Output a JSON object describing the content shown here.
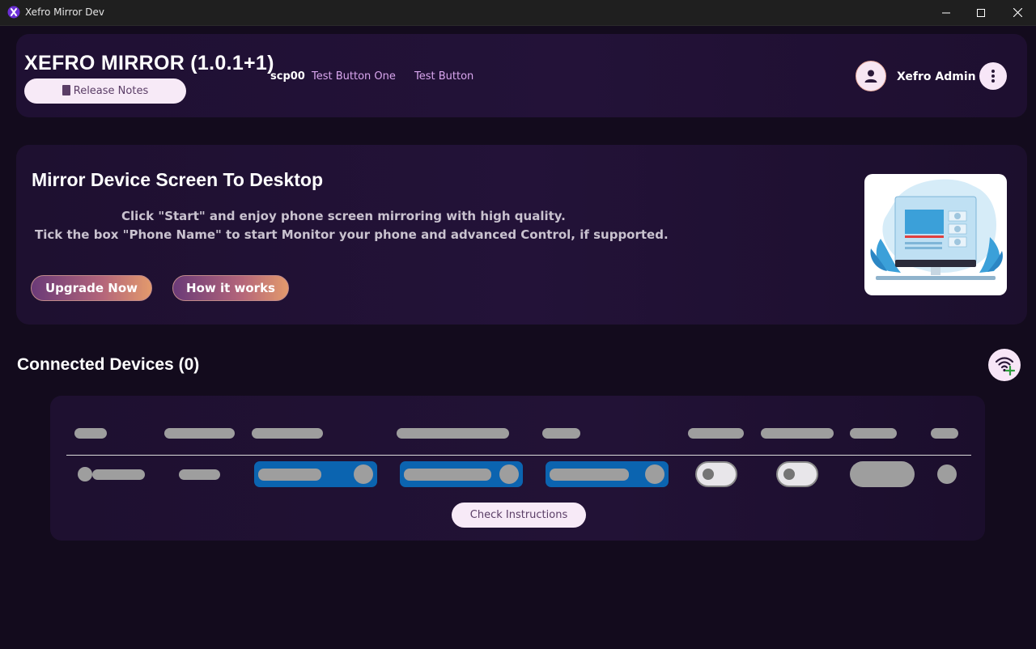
{
  "window": {
    "title": "Xefro Mirror Dev"
  },
  "header": {
    "app_name": "XEFRO MIRROR (1.0.1+1)",
    "release_notes_label": "Release Notes",
    "build_tag": "scp00",
    "test_button_one": "Test Button One",
    "test_button": "Test Button",
    "user_name": "Xefro Admin"
  },
  "hero": {
    "title": "Mirror Device Screen To Desktop",
    "line1": "Click \"Start\" and enjoy phone screen mirroring with high quality.",
    "line2": "Tick the box \"Phone Name\" to start Monitor your phone and advanced Control, if supported.",
    "upgrade_label": "Upgrade Now",
    "how_label": "How it works"
  },
  "devices": {
    "title": "Connected Devices (0)",
    "check_instructions_label": "Check Instructions"
  },
  "colors": {
    "background": "#130b1d",
    "card": "#231238",
    "accent_link": "#d9a6ee",
    "toggle_blue": "#0b64b0",
    "pill_bg": "#f7eaf7"
  },
  "icons": [
    "app-icon",
    "minimize-icon",
    "maximize-icon",
    "close-icon",
    "book-icon",
    "user-icon",
    "more-vertical-icon",
    "wifi-add-icon"
  ]
}
